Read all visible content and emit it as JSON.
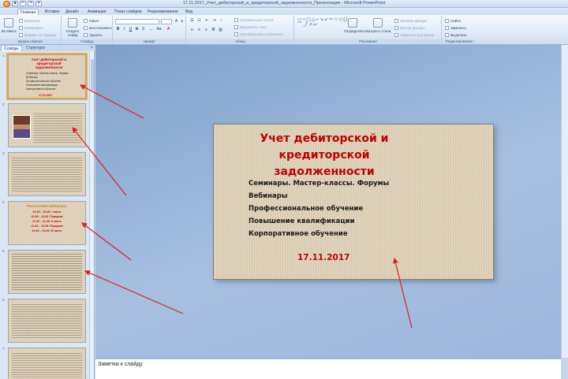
{
  "window": {
    "title": "17.11.2017_Учет_дебиторской_и_кредиторской_задолженности_Презентация - Microsoft PowerPoint"
  },
  "ribbon_tabs": [
    "Главная",
    "Вставка",
    "Дизайн",
    "Анимация",
    "Показ слайдов",
    "Рецензирование",
    "Вид"
  ],
  "ribbon": {
    "clipboard": {
      "label": "Буфер обмена",
      "paste": "Вставить",
      "cut": "Вырезать",
      "copy": "Копировать",
      "format_painter": "Формат по образцу"
    },
    "slides": {
      "label": "Слайды",
      "new_slide": "Создать слайд",
      "layout": "Макет",
      "reset": "Восстановить",
      "delete": "Удалить"
    },
    "font": {
      "label": "Шрифт"
    },
    "paragraph": {
      "label": "Абзац",
      "text_direction": "Направление текста",
      "align_text": "Выровнять текст",
      "smartart": "Преобразовать в SmartArt"
    },
    "drawing": {
      "label": "Рисование",
      "arrange": "Упорядочить",
      "quick_styles": "Экспресс-стили",
      "shape_fill": "Заливка фигуры",
      "shape_outline": "Контур фигуры",
      "shape_effects": "Эффекты для фигур"
    },
    "editing": {
      "label": "Редактирование",
      "find": "Найти",
      "replace": "Заменить",
      "select": "Выделить"
    }
  },
  "panel": {
    "tabs": [
      "Слайды",
      "Структура"
    ],
    "close": "×"
  },
  "thumbnails": {
    "numbers": [
      "1",
      "2",
      "3",
      "4",
      "5",
      "6",
      "7"
    ],
    "slide1": {
      "title": "Учет дебиторской и кредиторской задолженности",
      "lines": [
        "Семинары. Мастер-классы. Форумы",
        "Вебинары",
        "Профессиональное обучение",
        "Повышение квалификации",
        "Корпоративное обучение"
      ],
      "date": "17.11.2017"
    },
    "slide4": {
      "title": "Расписание вебинара:",
      "lines": [
        "10.00 – 10.45. I часть",
        "10.45 – 11.00. Перерыв",
        "11.00 – 11.45. II часть",
        "11.45 – 12.00. Перерыв",
        "12.00 – 13.00. III часть"
      ]
    }
  },
  "slide": {
    "title": "Учет дебиторской и кредиторской задолженности",
    "items": [
      "Семинары. Мастер-классы. Форумы",
      "Вебинары",
      "Профессиональное обучение",
      "Повышение квалификации",
      "Корпоративное обучение"
    ],
    "date": "17.11.2017"
  },
  "notes": {
    "placeholder": "Заметки к слайду"
  },
  "colors": {
    "title_red": "#c00000",
    "accent_orange": "#e07a18",
    "annotation_arrow": "#e02020",
    "slide_background": "#e0d3ba"
  }
}
